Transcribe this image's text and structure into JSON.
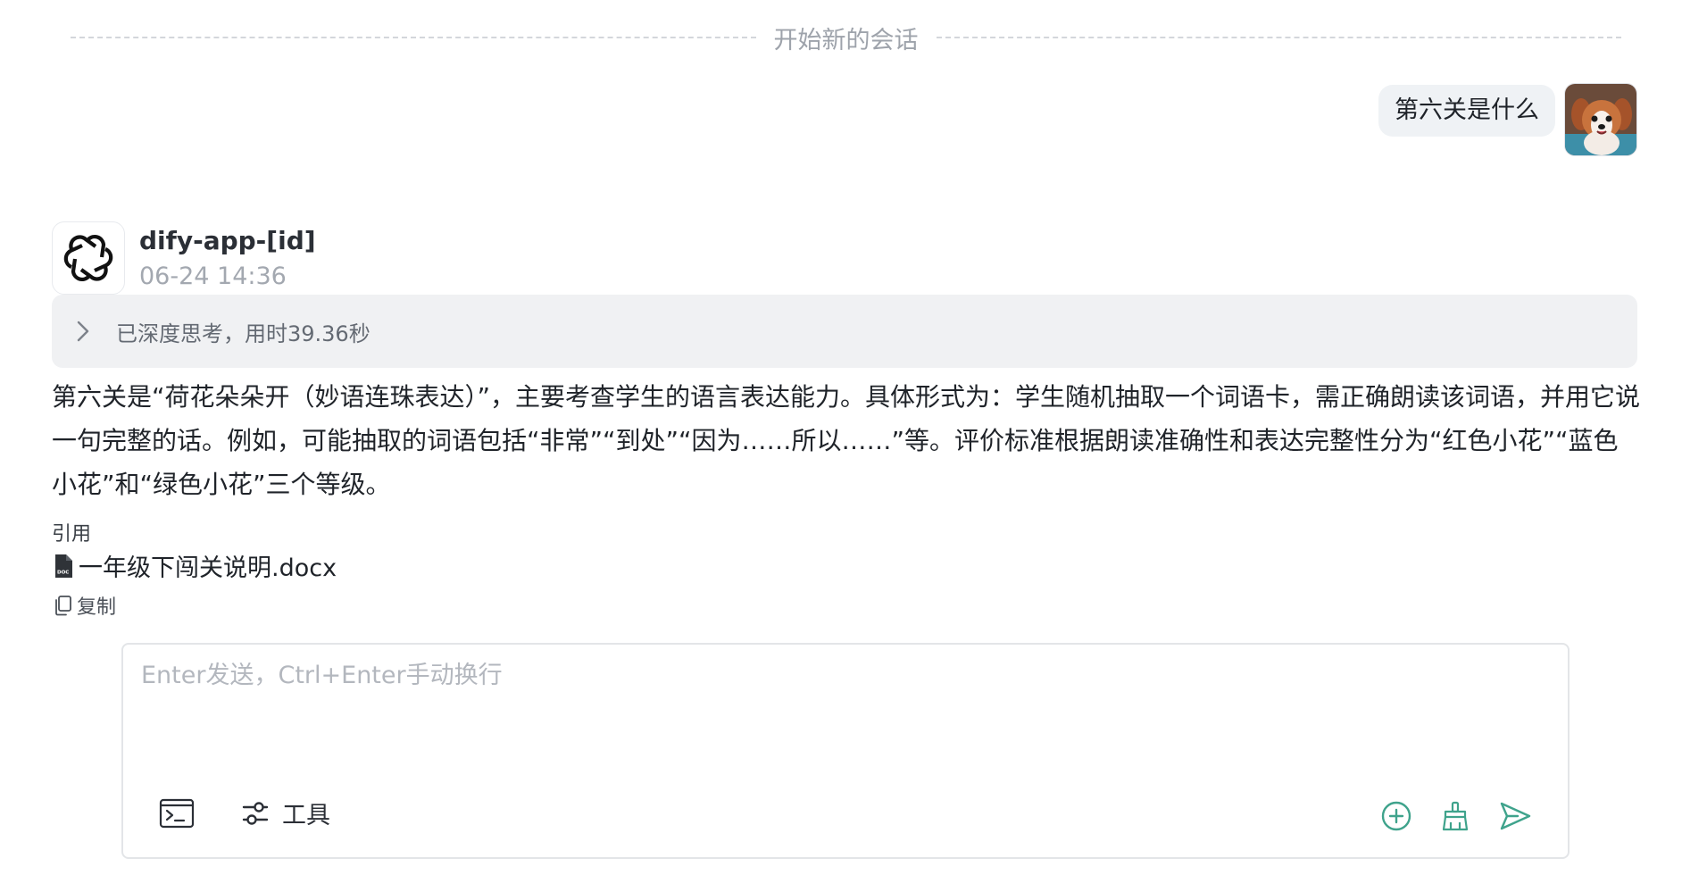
{
  "divider": {
    "label": "开始新的会话"
  },
  "user_message": {
    "text": "第六关是什么",
    "avatar": "puppy-avatar"
  },
  "bot": {
    "name": "dify-app-[id]",
    "time": "06-24 14:36",
    "avatar": "openai-logo-icon"
  },
  "thinking": {
    "label": "已深度思考，用时39.36秒",
    "icon": "chevron-right-icon"
  },
  "answer": {
    "text": "第六关是“荷花朵朵开（妙语连珠表达）”，主要考查学生的语言表达能力。具体形式为：学生随机抽取一个词语卡，需正确朗读该词语，并用它说一句完整的话。例如，可能抽取的词语包括“非常”“到处”“因为……所以……”等。评价标准根据朗读准确性和表达完整性分为“红色小花”“蓝色小花”和“绿色小花”三个等级。"
  },
  "citation": {
    "title": "引用",
    "file_name": "一年级下闯关说明.docx",
    "file_icon": "docx-file-icon"
  },
  "copy": {
    "label": "复制",
    "icon": "copy-icon"
  },
  "composer": {
    "placeholder": "Enter发送，Ctrl+Enter手动换行",
    "value": "",
    "tools_label": "工具",
    "icons": [
      "terminal-icon",
      "sliders-icon",
      "plus-circle-icon",
      "broom-icon",
      "send-icon"
    ]
  },
  "colors": {
    "accent": "#3fa38c",
    "think_bg": "#f0f1f3",
    "bubble_bg": "#eff2f5"
  }
}
